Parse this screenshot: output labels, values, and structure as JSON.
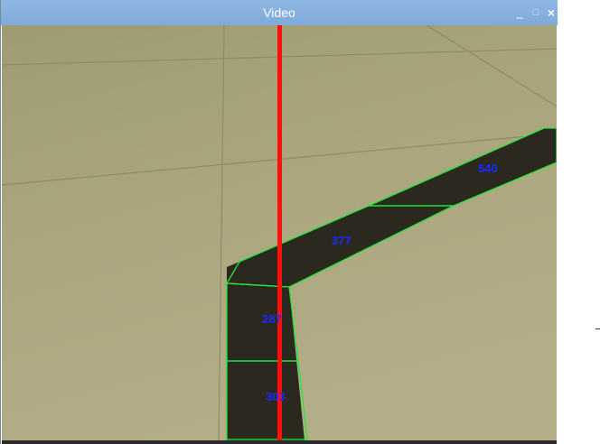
{
  "window": {
    "title": "Video",
    "minimize_glyph": "_",
    "maximize_glyph": "□",
    "close_glyph": "×"
  },
  "segments": [
    {
      "label": "540"
    },
    {
      "label": "377"
    },
    {
      "label": "287"
    },
    {
      "label": "303"
    }
  ],
  "colors": {
    "titlebar": "#87b0de",
    "floor": "#aaa57e",
    "track": "#2b2820",
    "outline": "#22e83a",
    "center_line": "#ff0f0f",
    "label_text": "#1a2cff"
  }
}
